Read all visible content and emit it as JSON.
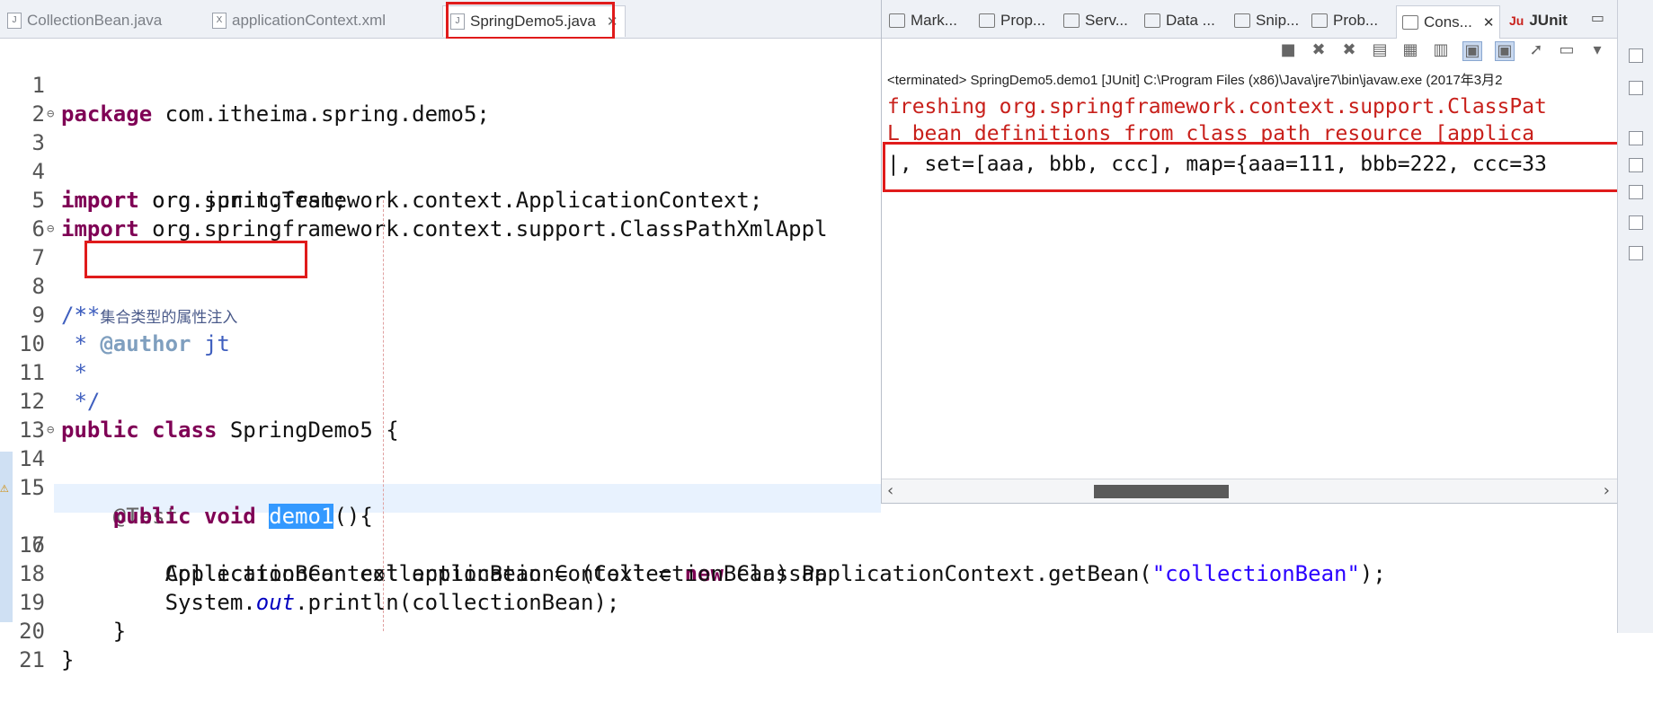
{
  "editor_tabs": [
    {
      "label": "CollectionBean.java",
      "icon": "java-file-icon",
      "active": false
    },
    {
      "label": "applicationContext.xml",
      "icon": "xml-file-icon",
      "active": false
    },
    {
      "label": "SpringDemo5.java",
      "icon": "java-file-icon",
      "active": true,
      "close": "✕"
    }
  ],
  "code_lines": [
    {
      "n": "1"
    },
    {
      "n": "2"
    },
    {
      "n": "3"
    },
    {
      "n": "4"
    },
    {
      "n": "5"
    },
    {
      "n": "6"
    },
    {
      "n": "7"
    },
    {
      "n": "8"
    },
    {
      "n": "9"
    },
    {
      "n": "10"
    },
    {
      "n": "11"
    },
    {
      "n": "12"
    },
    {
      "n": "13"
    },
    {
      "n": "14"
    },
    {
      "n": "15"
    },
    {
      "n": "16"
    },
    {
      "n": "17"
    },
    {
      "n": "18"
    },
    {
      "n": "19"
    },
    {
      "n": "20"
    },
    {
      "n": "21"
    }
  ],
  "code": {
    "l1_kw": "package",
    "l1_rest": " com.itheima.spring.demo5;",
    "l3_kw": "import",
    "l3_rest": " org.junit.Test;",
    "l4_kw": "import",
    "l4_rest": " org.springframework.context.ApplicationContext;",
    "l5_kw": "import",
    "l5_rest": " org.springframework.context.support.ClassPathXmlAppl",
    "l7": "/**",
    "l8_star": " * ",
    "l8_text": "集合类型的属性注入",
    "l9_star": " * ",
    "l9_tag": "@author",
    "l9_rest": " jt",
    "l10": " *",
    "l11": " */",
    "l12_kw1": "public",
    "l12_kw2": "class",
    "l12_rest": " SpringDemo5 {",
    "l14": "    @Test",
    "l15_kw1": "public",
    "l15_kw2": "void",
    "l15_sel": "demo1",
    "l15_rest": "(){",
    "l16": "        ApplicationContext applicationContext = ",
    "l16_kw": "new",
    "l16_rest": " ClassPa",
    "l17": "        CollectionBean collectionBean = (CollectionBean) applicationContext.getBean(",
    "l17_str": "\"collectionBean\"",
    "l17_rest": ");",
    "l18_a": "        System.",
    "l18_fld": "out",
    "l18_b": ".println(collectionBean);",
    "l19": "    }",
    "l20": "}"
  },
  "console": {
    "tabs": [
      {
        "label": "Mark...",
        "icon": "markers-icon"
      },
      {
        "label": "Prop...",
        "icon": "properties-icon"
      },
      {
        "label": "Serv...",
        "icon": "servers-icon"
      },
      {
        "label": "Data ...",
        "icon": "data-source-icon"
      },
      {
        "label": "Snip...",
        "icon": "snippets-icon"
      },
      {
        "label": "Prob...",
        "icon": "problems-icon"
      },
      {
        "label": "Cons...",
        "icon": "console-icon",
        "active": true,
        "close": "✕"
      },
      {
        "label": "JUnit",
        "icon": "junit-icon"
      }
    ],
    "minimize": "▭",
    "terminated": "<terminated> SpringDemo5.demo1 [JUnit] C:\\Program Files (x86)\\Java\\jre7\\bin\\javaw.exe (2017年3月2",
    "output": [
      "freshing org.springframework.context.support.ClassPat",
      "L bean definitions from class path resource [applica",
      "|, set=[aaa, bbb, ccc], map={aaa=111, bbb=222, ccc=33"
    ],
    "scroll_left": "‹",
    "scroll_right": "›",
    "scroll_position": 0.5
  }
}
